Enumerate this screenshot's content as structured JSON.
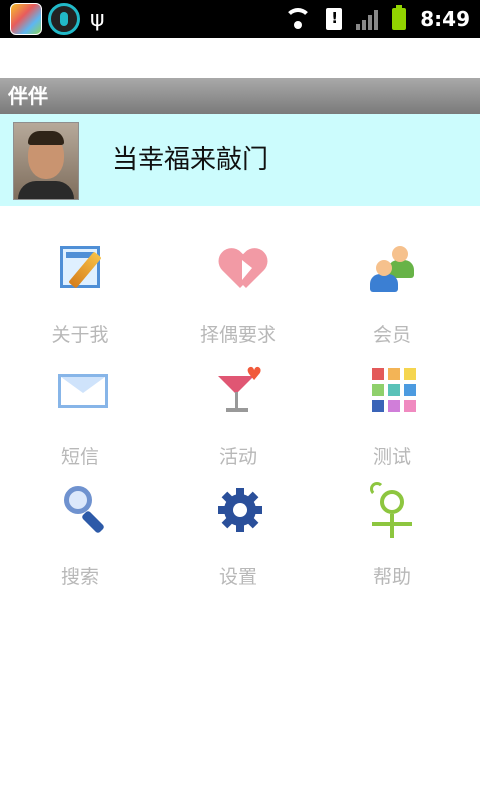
{
  "status_bar": {
    "time": "8:49",
    "icons": [
      "app-notification-icon",
      "sync-notification-icon",
      "usb-icon",
      "wifi-icon",
      "sim-alert-icon",
      "signal-icon",
      "battery-icon"
    ]
  },
  "title_bar": {
    "title": "伴伴"
  },
  "profile": {
    "name": "当幸福来敲门"
  },
  "menu": {
    "items": [
      {
        "label": "关于我",
        "icon": "profile-edit-icon"
      },
      {
        "label": "择偶要求",
        "icon": "heart-cursor-icon"
      },
      {
        "label": "会员",
        "icon": "members-icon"
      },
      {
        "label": "短信",
        "icon": "envelope-icon"
      },
      {
        "label": "活动",
        "icon": "cocktail-icon"
      },
      {
        "label": "测试",
        "icon": "color-grid-icon"
      },
      {
        "label": "搜索",
        "icon": "magnifier-icon"
      },
      {
        "label": "设置",
        "icon": "gear-icon"
      },
      {
        "label": "帮助",
        "icon": "help-icon"
      }
    ]
  },
  "colors": {
    "profile_bg": "#ccfcfd",
    "title_bar": "#8c8c8c",
    "menu_label": "#b8b8b8",
    "battery": "#92d400"
  }
}
